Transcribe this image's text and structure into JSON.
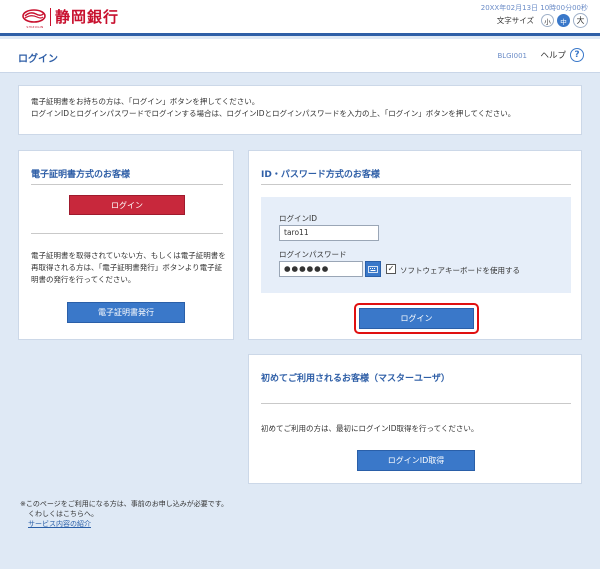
{
  "header": {
    "bank_name": "静岡銀行",
    "logo_sub": "SHIZUGIN",
    "datetime": "20XX年02月13日 10時00分00秒",
    "font_size_label": "文字サイズ",
    "font_small": "小",
    "font_medium": "中",
    "font_large": "大"
  },
  "titlebar": {
    "title": "ログイン",
    "screen_id": "BLGI001",
    "help_label": "ヘルプ",
    "help_icon": "?"
  },
  "info": {
    "line1": "電子証明書をお持ちの方は、「ログイン」ボタンを押してください。",
    "line2": "ログインIDとログインパスワードでログインする場合は、ログインIDとログインパスワードを入力の上、「ログイン」ボタンを押してください。"
  },
  "cert_panel": {
    "title": "電子証明書方式のお客様",
    "login_label": "ログイン",
    "description": "電子証明書を取得されていない方、もしくは電子証明書を再取得される方は、「電子証明書発行」ボタンより電子証明書の発行を行ってください。",
    "issue_label": "電子証明書発行"
  },
  "id_panel": {
    "title": "ID・パスワード方式のお客様",
    "login_id_label": "ログインID",
    "login_id_value": "taro11",
    "password_label": "ログインパスワード",
    "password_value": "●●●●●●",
    "keyboard_label": "ソフトウェアキーボードを使用する",
    "checkbox_mark": "✓",
    "login_label": "ログイン"
  },
  "master_panel": {
    "title": "初めてご利用されるお客様（マスターユーザ）",
    "description": "初めてご利用の方は、最初にログインID取得を行ってください。",
    "button_label": "ログインID取得"
  },
  "footer": {
    "note1": "※このページをご利用になる方は、事前のお申し込みが必要です。",
    "note2": "くわしくはこちらへ。",
    "link": "サービス内容の紹介"
  },
  "colors": {
    "brand_red": "#c8102e",
    "primary_blue": "#3a78c9",
    "highlight_red": "#e01010",
    "background": "#dfe9f5"
  }
}
